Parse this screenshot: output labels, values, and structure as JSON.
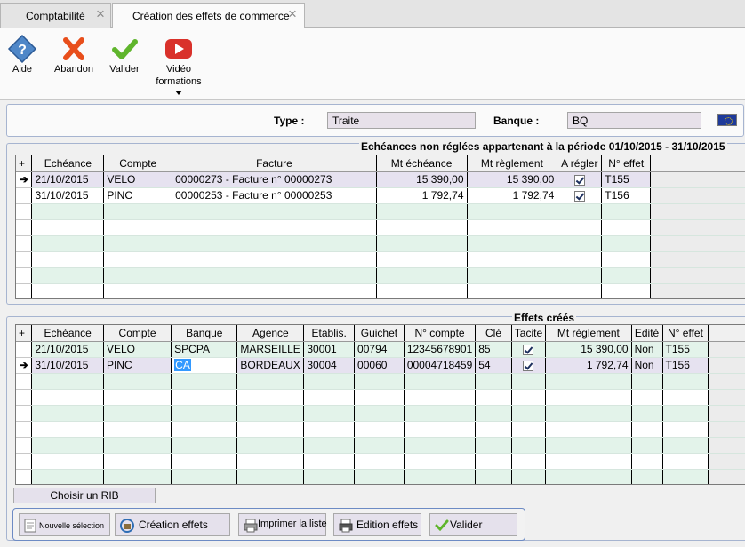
{
  "tabs": [
    {
      "label": "Comptabilité",
      "close": "×"
    },
    {
      "label": "Création des effets de commerce",
      "close": "×"
    }
  ],
  "toolbar": {
    "aide": "Aide",
    "abandon": "Abandon",
    "valider": "Valider",
    "video_line1": "Vidéo",
    "video_line2": "formations"
  },
  "header": {
    "type_label": "Type :",
    "type_value": "Traite",
    "banque_label": "Banque :",
    "banque_value": "BQ"
  },
  "echeances": {
    "title": "Echéances non réglées appartenant à la période 01/10/2015 - 31/10/2015",
    "columns": [
      "Echéance",
      "Compte",
      "Facture",
      "Mt échéance",
      "Mt règlement",
      "A régler",
      "N° effet"
    ],
    "rows": [
      {
        "echeance": "21/10/2015",
        "compte": "VELO",
        "facture": "00000273 - Facture n° 00000273",
        "mt_echeance": "15 390,00",
        "mt_reglement": "15 390,00",
        "a_regler": true,
        "n_effet": "T155"
      },
      {
        "echeance": "31/10/2015",
        "compte": "PINC",
        "facture": "00000253 - Facture n° 00000253",
        "mt_echeance": "1 792,74",
        "mt_reglement": "1 792,74",
        "a_regler": true,
        "n_effet": "T156"
      }
    ]
  },
  "effets": {
    "title": "Effets créés",
    "columns": [
      "Echéance",
      "Compte",
      "Banque",
      "Agence",
      "Etablis.",
      "Guichet",
      "N° compte",
      "Clé",
      "Tacite",
      "Mt règlement",
      "Edité",
      "N° effet"
    ],
    "rows": [
      {
        "echeance": "21/10/2015",
        "compte": "VELO",
        "banque": "SPCPA",
        "agence": "MARSEILLE",
        "etablis": "30001",
        "guichet": "00794",
        "n_compte": "12345678901",
        "cle": "85",
        "tacite": true,
        "mt_reglement": "15 390,00",
        "edite": "Non",
        "n_effet": "T155"
      },
      {
        "echeance": "31/10/2015",
        "compte": "PINC",
        "banque": "CA",
        "agence": "BORDEAUX",
        "etablis": "30004",
        "guichet": "00060",
        "n_compte": "00004718459",
        "cle": "54",
        "tacite": true,
        "mt_reglement": "1 792,74",
        "edite": "Non",
        "n_effet": "T156"
      }
    ]
  },
  "buttons": {
    "choisir_rib": "Choisir un RIB",
    "nouvelle_selection": "Nouvelle sélection",
    "creation_effets": "Création effets",
    "imprimer_liste": "Imprimer la liste",
    "edition_effets": "Edition effets",
    "valider": "Valider"
  },
  "colors": {
    "row_alt": "#e3f3ea",
    "row_current": "#e6e2f0",
    "field_bg": "#e7e1ea",
    "panel_border": "#a6b4d0"
  }
}
